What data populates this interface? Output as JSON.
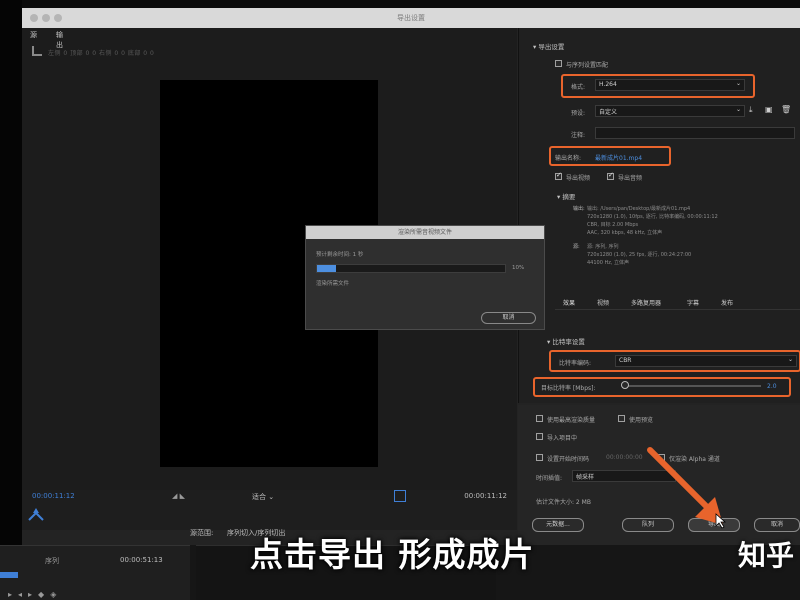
{
  "window": {
    "title": "导出设置"
  },
  "preview": {
    "tabs": [
      "源",
      "输出"
    ],
    "crop_options": "左侧  0   顶部 0  0   右侧 0  0   底部 0  0",
    "time_start": "00:00:11:12",
    "time_end": "00:00:11:12",
    "fit_label": "适合",
    "source_range_label": "源范围:",
    "source_range_value": "序列切入/序列切出"
  },
  "settings": {
    "section_title": "导出设置",
    "match_sequence_label": "与序列设置匹配",
    "format_label": "格式:",
    "format_value": "H.264",
    "preset_label": "预设:",
    "preset_value": "自定义",
    "comment_label": "注释:",
    "output_name_label": "输出名称:",
    "output_name_value": "最新成片01.mp4",
    "export_video_label": "导出视频",
    "export_audio_label": "导出音频",
    "summary_label": "摘要",
    "summary_output_lines": [
      "输出: /Users/pan/Desktop/最新成片01.mp4",
      "720x1280 (1.0), 10fps, 逐行, 比特率编码, 00:00:11:12",
      "CBR, 目标 2.00 Mbps",
      "AAC, 320 kbps, 48 kHz, 立体声"
    ],
    "summary_source_lines": [
      "源: 序列, 序列",
      "720x1280 (1.0), 25 fps, 逐行, 00:24:27:00",
      "44100 Hz, 立体声"
    ],
    "summary_output_key": "输出:",
    "summary_source_key": "源:",
    "tabs": [
      "效果",
      "视频",
      "多路复用器",
      "字幕",
      "发布"
    ],
    "bitrate_section": "比特率设置",
    "bitrate_encoding_label": "比特率编码:",
    "bitrate_encoding_value": "CBR",
    "target_bitrate_label": "目标比特率 [Mbps]:",
    "target_bitrate_value": "2.0"
  },
  "lower": {
    "max_render_quality": "使用最高渲染质量",
    "use_previews": "使用预览",
    "import_project": "导入项目中",
    "set_start_timecode": "设置开始时间码",
    "start_timecode_value": "00:00:00:00",
    "render_alpha_only": "仅渲染 Alpha 通道",
    "time_interp_label": "时间插值:",
    "time_interp_value": "帧采样",
    "est_size_label": "估计文件大小: 2 MB",
    "metadata_button": "元数据...",
    "queue_button": "队列",
    "export_button": "导出",
    "cancel_button": "取消"
  },
  "render_dialog": {
    "title": "渲染所需音视频文件",
    "remaining": "预计剩余时间: 1 秒",
    "progress_fraction": 0.1,
    "percent_text": "10%",
    "status": "渲染所需文件",
    "cancel_label": "取消"
  },
  "bottom": {
    "sequence_label": "序列",
    "time": "00:00:51:13"
  },
  "overlay": {
    "caption": "点击导出 形成成片",
    "watermark": "知乎"
  },
  "colors": {
    "accent_blue": "#3f7fd6",
    "highlight_orange": "#e8642c",
    "progress_blue": "#4d8fe0"
  }
}
